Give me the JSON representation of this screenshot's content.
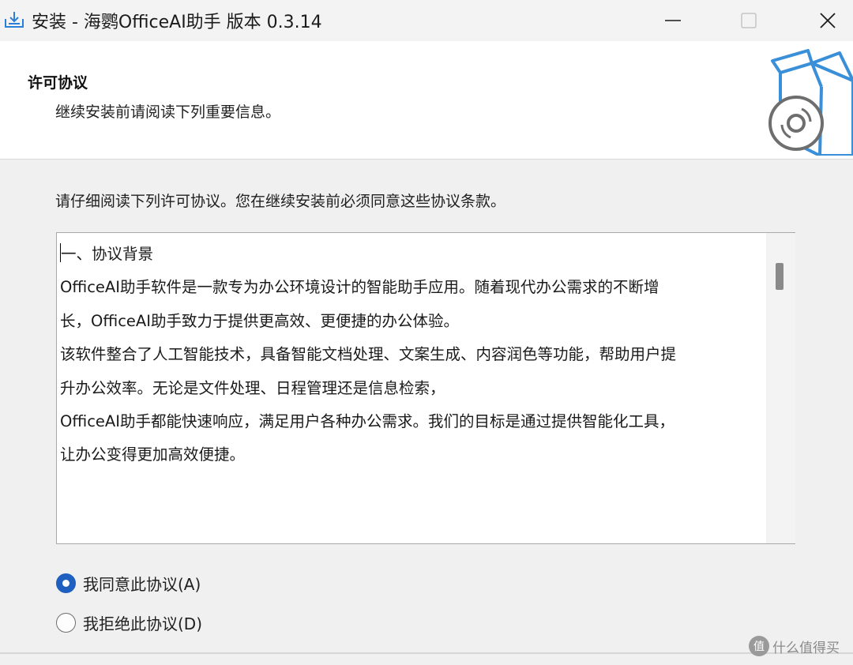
{
  "window": {
    "title": "安装 - 海鹦OfficeAI助手 版本 0.3.14",
    "app_icon": "installer-download-icon",
    "controls": {
      "minimize_icon": "minimize-icon",
      "maximize_icon": "maximize-icon",
      "close_icon": "close-icon"
    }
  },
  "header": {
    "title": "许可协议",
    "subtitle": "继续安装前请阅读下列重要信息。",
    "graphic_icon": "software-box-disc-icon"
  },
  "main": {
    "instruction": "请仔细阅读下列许可协议。您在继续安装前必须同意这些协议条款。",
    "license_lines": [
      "一、协议背景",
      "OfficeAI助手软件是一款专为办公环境设计的智能助手应用。随着现代办公需求的不断增",
      "长，OfficeAI助手致力于提供更高效、更便捷的办公体验。",
      "该软件整合了人工智能技术，具备智能文档处理、文案生成、内容润色等功能，帮助用户提",
      "升办公效率。无论是文件处理、日程管理还是信息检索，",
      "OfficeAI助手都能快速响应，满足用户各种办公需求。我们的目标是通过提供智能化工具，",
      "让办公变得更加高效便捷。"
    ],
    "options": [
      {
        "label": "我同意此协议(A)",
        "selected": true
      },
      {
        "label": "我拒绝此协议(D)",
        "selected": false
      }
    ]
  },
  "watermark": {
    "text": "什么值得买",
    "logo_text": "值"
  },
  "colors": {
    "accent": "#1f5fbf",
    "box_outline": "#3a8fd9",
    "window_bg": "#f0f0f0",
    "header_bg": "#ffffff"
  }
}
